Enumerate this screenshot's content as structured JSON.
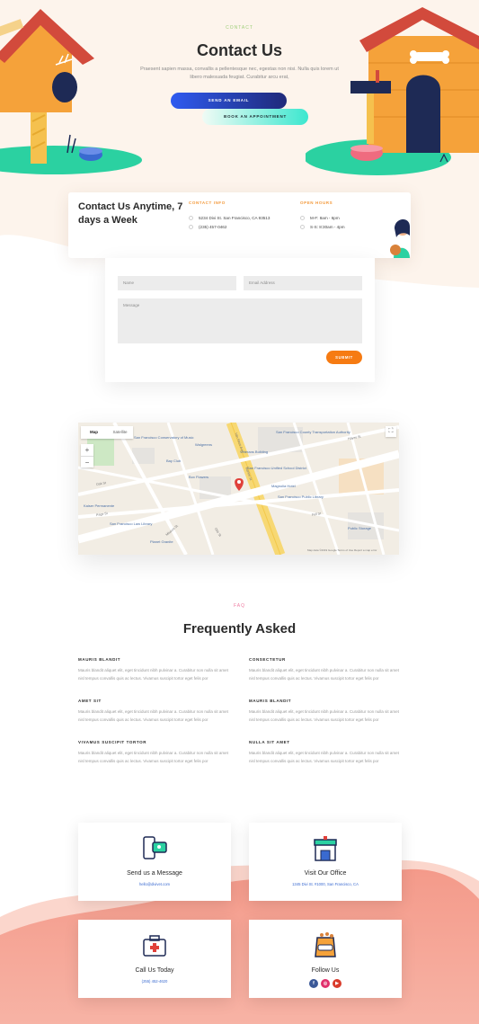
{
  "hero": {
    "eyebrow": "CONTACT",
    "title": "Contact Us",
    "text": "Praesent sapien massa, convallis a pellentesque nec, egestas non nisi. Nulla quis lorem ut libero malesuada feugiat. Curabitur arcu erat,",
    "email_button": "SEND AN EMAIL",
    "appointment_button": "BOOK AN APPOINTMENT"
  },
  "info": {
    "title": "Contact Us Anytime, 7 days a Week",
    "contact_heading": "CONTACT INFO",
    "address": "5234 Divi St. San Francisco, CA 93513",
    "phone": "(235) 457-0462",
    "hours_heading": "OPEN HOURS",
    "hours_weekday": "M-F: 8am - 6pm",
    "hours_weekend": "S-S: 8:30am - 4pm"
  },
  "form": {
    "name_placeholder": "Name",
    "email_placeholder": "Email Address",
    "message_placeholder": "Message",
    "submit_label": "SUBMIT"
  },
  "map": {
    "tab_map": "Map",
    "tab_satellite": "Satellite",
    "zoom_in": "+",
    "zoom_out": "−",
    "labels": [
      "San Francisco Conservatory of Music",
      "Box Flowers",
      "San Francisco County Transportation Authority",
      "Veterans Building",
      "Walgreens",
      "San Francisco Unified School District",
      "Bay Club",
      "Magnolia Hotel",
      "San Francisco Public Library",
      "Kaiser Permanente",
      "San Francisco Law Library",
      "Planet Granite",
      "Public Storage"
    ],
    "streets": [
      "Market St",
      "Van Ness Ave",
      "Hayes St",
      "Mission St",
      "Fell St",
      "Oak St",
      "Page St",
      "Otis St"
    ],
    "attribution": "Map data ©2019 Google   Terms of Use   Report a map error"
  },
  "faq": {
    "eyebrow": "FAQ",
    "title": "Frequently Asked",
    "items": [
      {
        "q": "MAURIS BLANDIT",
        "a": "Mauris blandit aliquet elit, eget tincidunt nibh pulvinar a. Curabitur non nulla sit amet nisl tempus convallis quis ac lectus. Vivamus suscipit tortor eget felis por"
      },
      {
        "q": "CONSECTETUR",
        "a": "Mauris blandit aliquet elit, eget tincidunt nibh pulvinar a. Curabitur non nulla sit amet nisl tempus convallis quis ac lectus. Vivamus suscipit tortor eget felis por"
      },
      {
        "q": "AMET SIT",
        "a": "Mauris blandit aliquet elit, eget tincidunt nibh pulvinar a. Curabitur non nulla sit amet nisl tempus convallis quis ac lectus. Vivamus suscipit tortor eget felis por"
      },
      {
        "q": "MAURIS BLANDIT",
        "a": "Mauris blandit aliquet elit, eget tincidunt nibh pulvinar a. Curabitur non nulla sit amet nisl tempus convallis quis ac lectus. Vivamus suscipit tortor eget felis por"
      },
      {
        "q": "VIVAMUS SUSCIPIT TORTOR",
        "a": "Mauris blandit aliquet elit, eget tincidunt nibh pulvinar a. Curabitur non nulla sit amet nisl tempus convallis quis ac lectus. Vivamus suscipit tortor eget felis por"
      },
      {
        "q": "NULLA SIT AMET",
        "a": "Mauris blandit aliquet elit, eget tincidunt nibh pulvinar a. Curabitur non nulla sit amet nisl tempus convallis quis ac lectus. Vivamus suscipit tortor eget felis por"
      }
    ]
  },
  "cards": {
    "message_title": "Send us a Message",
    "message_sub": "hello@divivet.com",
    "office_title": "Visit Our Office",
    "office_sub": "1345 Divi St. #1000, San Francisco, CA",
    "call_title": "Call Us Today",
    "call_sub": "(255) 452-4620",
    "follow_title": "Follow Us"
  },
  "colors": {
    "accent_orange": "#f67b12",
    "blue": "#2f5bf0",
    "teal": "#3ce7cf",
    "coral": "#f49a8a",
    "peach_bg": "#fdf4ec"
  }
}
